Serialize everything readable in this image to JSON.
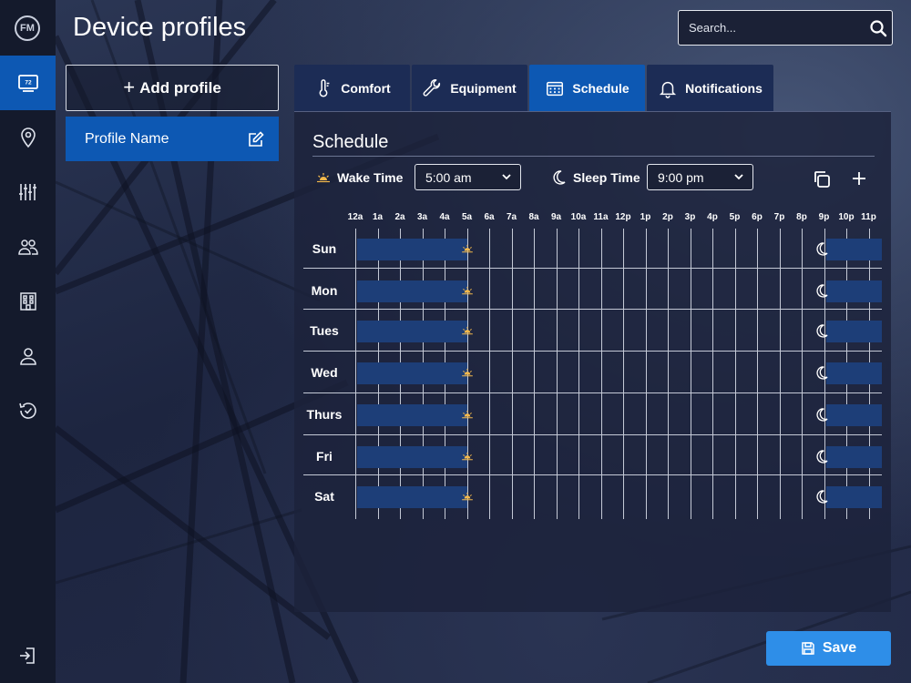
{
  "app": {
    "logo_text": "FM",
    "page_title": "Device profiles"
  },
  "search": {
    "placeholder": "Search..."
  },
  "nav": {
    "items": [
      {
        "icon": "thermostat-icon",
        "active": true,
        "badge": "72"
      },
      {
        "icon": "location-pin-icon",
        "active": false
      },
      {
        "icon": "sliders-icon",
        "active": false
      },
      {
        "icon": "users-icon",
        "active": false
      },
      {
        "icon": "building-icon",
        "active": false
      },
      {
        "icon": "user-icon",
        "active": false
      },
      {
        "icon": "history-check-icon",
        "active": false
      }
    ],
    "logout_icon": "logout-icon"
  },
  "profiles": {
    "add_label": "Add profile",
    "items": [
      {
        "name": "Profile Name",
        "active": true
      }
    ]
  },
  "tabs": [
    {
      "label": "Comfort",
      "icon": "thermometer-icon",
      "active": false
    },
    {
      "label": "Equipment",
      "icon": "wrench-icon",
      "active": false
    },
    {
      "label": "Schedule",
      "icon": "calendar-icon",
      "active": true
    },
    {
      "label": "Notifications",
      "icon": "bell-icon",
      "active": false
    }
  ],
  "schedule": {
    "title": "Schedule",
    "wake_label": "Wake Time",
    "wake_value": "5:00 am",
    "sleep_label": "Sleep Time",
    "sleep_value": "9:00 pm",
    "hours": [
      "12a",
      "1a",
      "2a",
      "3a",
      "4a",
      "5a",
      "6a",
      "7a",
      "8a",
      "9a",
      "10a",
      "11a",
      "12p",
      "1p",
      "2p",
      "3p",
      "4p",
      "5p",
      "6p",
      "7p",
      "8p",
      "9p",
      "10p",
      "11p"
    ],
    "days": [
      "Sun",
      "Mon",
      "Tues",
      "Wed",
      "Thurs",
      "Fri",
      "Sat"
    ],
    "wake_hour": 5,
    "sleep_hour": 21
  },
  "save_label": "Save",
  "colors": {
    "accent": "#0d58b3",
    "save": "#2e8ee8",
    "sleep_bar": "#1d3e78",
    "sun": "#f2b84b"
  }
}
